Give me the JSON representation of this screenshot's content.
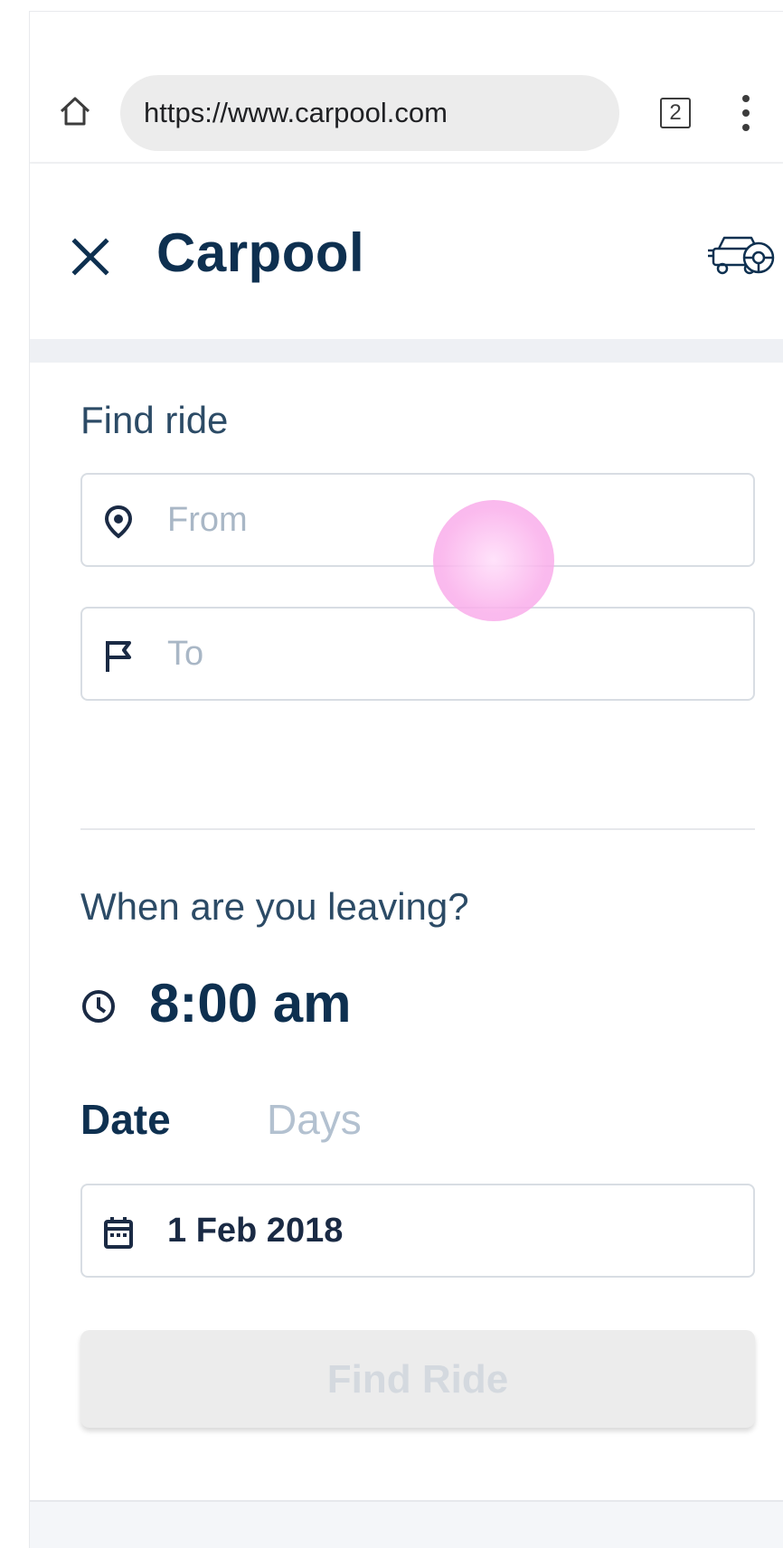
{
  "browser": {
    "url": "https://www.carpool.com",
    "tab_count": "2",
    "home_icon": "home-icon",
    "menu_icon": "more-vert-icon"
  },
  "header": {
    "title": "Carpool",
    "close_icon": "close-icon",
    "car_icon": "car-icon"
  },
  "find_ride": {
    "section_label": "Find ride",
    "from": {
      "placeholder": "From",
      "value": "",
      "icon": "location-pin-icon"
    },
    "to": {
      "placeholder": "To",
      "value": "",
      "icon": "flag-icon"
    }
  },
  "schedule": {
    "question": "When are you leaving?",
    "time": "8:00 am",
    "tabs": [
      {
        "label": "Date",
        "selected": true
      },
      {
        "label": "Days",
        "selected": false
      }
    ],
    "date_value": "1 Feb 2018"
  },
  "actions": {
    "find_ride_button": "Find Ride",
    "find_ride_enabled": false
  },
  "colors": {
    "primary_text": "#0e3050",
    "muted_text": "#b3c1d0",
    "button_disabled_bg": "#ececec",
    "touch_indicator": "#f9b4ec"
  }
}
